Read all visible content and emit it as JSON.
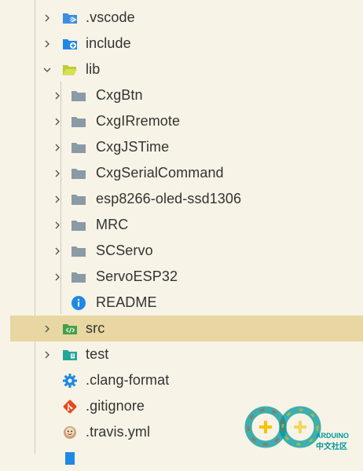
{
  "explorer": {
    "items": [
      {
        "label": ".vscode",
        "icon": "vscode-folder-icon",
        "expanded": false
      },
      {
        "label": "include",
        "icon": "include-folder-icon",
        "expanded": false
      },
      {
        "label": "lib",
        "icon": "lib-folder-open-icon",
        "expanded": true
      },
      {
        "label": "CxgBtn",
        "icon": "folder-icon",
        "expanded": false
      },
      {
        "label": "CxgIRremote",
        "icon": "folder-icon",
        "expanded": false
      },
      {
        "label": "CxgJSTime",
        "icon": "folder-icon",
        "expanded": false
      },
      {
        "label": "CxgSerialCommand",
        "icon": "folder-icon",
        "expanded": false
      },
      {
        "label": "esp8266-oled-ssd1306",
        "icon": "folder-icon",
        "expanded": false
      },
      {
        "label": "MRC",
        "icon": "folder-icon",
        "expanded": false
      },
      {
        "label": "SCServo",
        "icon": "folder-icon",
        "expanded": false
      },
      {
        "label": "ServoESP32",
        "icon": "folder-icon",
        "expanded": false
      },
      {
        "label": "README",
        "icon": "info-icon"
      },
      {
        "label": "src",
        "icon": "src-folder-icon",
        "expanded": false,
        "selected": true
      },
      {
        "label": "test",
        "icon": "test-folder-icon",
        "expanded": false
      },
      {
        "label": ".clang-format",
        "icon": "gear-icon"
      },
      {
        "label": ".gitignore",
        "icon": "git-icon"
      },
      {
        "label": ".travis.yml",
        "icon": "travis-icon"
      }
    ]
  },
  "watermark": {
    "brand": "ARDUINO",
    "subtitle": "中文社区"
  },
  "colors": {
    "background": "#f7f3e6",
    "selected_row": "#e8d7a2",
    "folder_gray": "#8a9aa6",
    "vscode_blue": "#3a8fe0",
    "include_blue": "#1e88e5",
    "lib_green": "#c0ca33",
    "src_green": "#43a047",
    "test_teal": "#26a69a",
    "info_blue": "#1e88e5",
    "git_orange": "#e64a19"
  }
}
